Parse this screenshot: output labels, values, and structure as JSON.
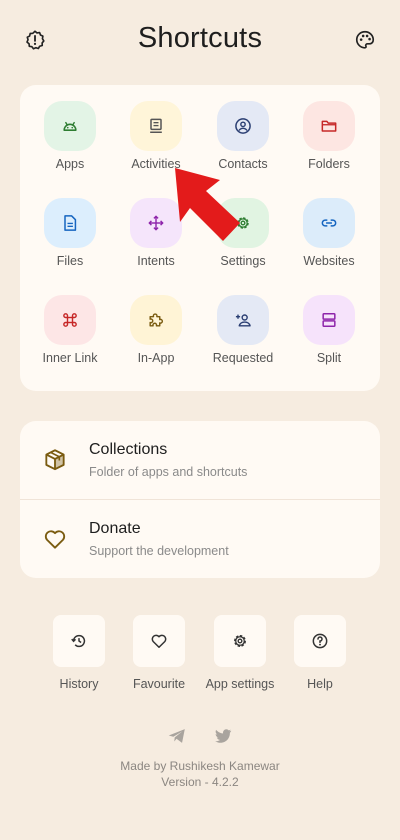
{
  "header": {
    "title": "Shortcuts",
    "left_icon": "info-icon",
    "right_icon": "palette-icon"
  },
  "grid": {
    "items": [
      {
        "label": "Apps",
        "icon": "android-icon",
        "bg": "#e3f4e6",
        "fg": "#2e7d32"
      },
      {
        "label": "Activities",
        "icon": "list-icon",
        "bg": "#fff5d9",
        "fg": "#555555"
      },
      {
        "label": "Contacts",
        "icon": "account-icon",
        "bg": "#e4e9f5",
        "fg": "#2b3f73"
      },
      {
        "label": "Folders",
        "icon": "folder-icon",
        "bg": "#fde6e2",
        "fg": "#c62828"
      },
      {
        "label": "Files",
        "icon": "file-icon",
        "bg": "#dceefd",
        "fg": "#1565c0"
      },
      {
        "label": "Intents",
        "icon": "arrows-icon",
        "bg": "#f5e5fb",
        "fg": "#8e24aa"
      },
      {
        "label": "Settings",
        "icon": "gear-icon",
        "bg": "#e1f4e2",
        "fg": "#2e7d32"
      },
      {
        "label": "Websites",
        "icon": "link-icon",
        "bg": "#dcecfa",
        "fg": "#1565c0"
      },
      {
        "label": "Inner Link",
        "icon": "command-icon",
        "bg": "#fde6e6",
        "fg": "#c62828"
      },
      {
        "label": "In-App",
        "icon": "puzzle-icon",
        "bg": "#fff4d6",
        "fg": "#7a5b10"
      },
      {
        "label": "Requested",
        "icon": "person-add-icon",
        "bg": "#e4e9f5",
        "fg": "#2b3f73"
      },
      {
        "label": "Split",
        "icon": "split-icon",
        "bg": "#f6e3fb",
        "fg": "#8e24aa"
      }
    ]
  },
  "list": {
    "items": [
      {
        "title": "Collections",
        "subtitle": "Folder of apps and shortcuts",
        "icon": "box-icon"
      },
      {
        "title": "Donate",
        "subtitle": "Support the development",
        "icon": "heart-icon"
      }
    ]
  },
  "bottom": {
    "items": [
      {
        "label": "History",
        "icon": "history-icon"
      },
      {
        "label": "Favourite",
        "icon": "heart-icon"
      },
      {
        "label": "App settings",
        "icon": "gear-icon"
      },
      {
        "label": "Help",
        "icon": "help-icon"
      }
    ]
  },
  "footer": {
    "social": [
      "telegram-icon",
      "twitter-icon"
    ],
    "made_by": "Made by Rushikesh Kamewar",
    "version": "Version - 4.2.2"
  },
  "colors": {
    "background": "#f6ece0",
    "card": "#fffaf4",
    "list_icon": "#7a5b10",
    "annotation_arrow": "#e31b1b"
  }
}
